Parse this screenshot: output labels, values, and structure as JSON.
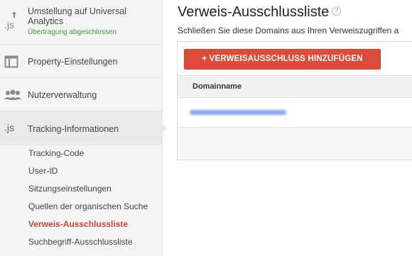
{
  "sidebar": {
    "top_item": {
      "icon": "js-upload-icon",
      "icon_text": ".js",
      "label_line1": "Umstellung auf Universal",
      "label_line2": "Analytics",
      "status": "Übertragung abgeschlossen",
      "status_color": "#3d9a3d"
    },
    "property_settings": {
      "icon": "window-icon",
      "label": "Property-Einstellungen"
    },
    "user_management": {
      "icon": "users-icon",
      "label": "Nutzerverwaltung"
    },
    "tracking_info": {
      "icon": "js-icon",
      "icon_text": ".js",
      "label": "Tracking-Informationen"
    },
    "sub_items": [
      {
        "label": "Tracking-Code",
        "active": false
      },
      {
        "label": "User-ID",
        "active": false
      },
      {
        "label": "Sitzungseinstellungen",
        "active": false
      },
      {
        "label": "Quellen der organischen Suche",
        "active": false
      },
      {
        "label": "Verweis-Ausschlussliste",
        "active": true
      },
      {
        "label": "Suchbegriff-Ausschlussliste",
        "active": false
      }
    ]
  },
  "main": {
    "title": "Verweis-Ausschlussliste",
    "help_icon": "?",
    "description": "Schließen Sie diese Domains aus Ihren Verweiszugriffen a",
    "add_button_label": "+ VERWEISAUSSCHLUSS HINZUFÜGEN",
    "table": {
      "column_header": "Domainname",
      "rows": [
        {
          "domain": "redacted"
        }
      ]
    }
  },
  "colors": {
    "accent_button": "#dd4b39",
    "active_link": "#d9442e",
    "success_text": "#3d9a3d"
  }
}
